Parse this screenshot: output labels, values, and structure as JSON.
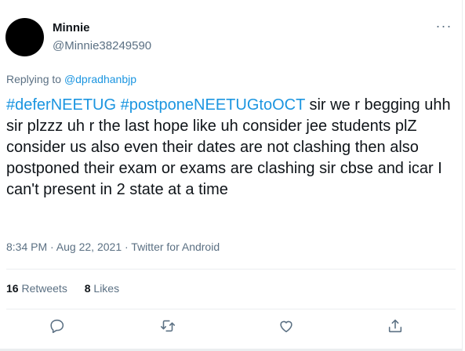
{
  "tweet": {
    "display_name": "Minnie",
    "handle": "@Minnie38249590",
    "more_label": "···",
    "replying_prefix": "Replying to ",
    "replying_to": "@dpradhanbjp",
    "hashtag_1": "#deferNEETUG",
    "hashtag_2": "#postponeNEETUGtoOCT",
    "text": " sir we r begging uhh sir plzzz uh r the last hope like uh consider jee students plZ consider us also even their dates are not clashing then also postponed their exam or exams are clashing sir cbse and icar I can't present in 2 state at a time",
    "meta": "8:34 PM · Aug 22, 2021 · Twitter for Android"
  },
  "stats": {
    "retweets_count": "16",
    "retweets_label": " Retweets",
    "likes_count": "8",
    "likes_label": " Likes"
  },
  "actions": [
    "reply-icon",
    "retweet-icon",
    "like-icon",
    "share-icon"
  ],
  "colors": {
    "link": "#1b95e0",
    "muted": "#5b7083",
    "text": "#0f1419",
    "divider": "#ebeef0"
  }
}
